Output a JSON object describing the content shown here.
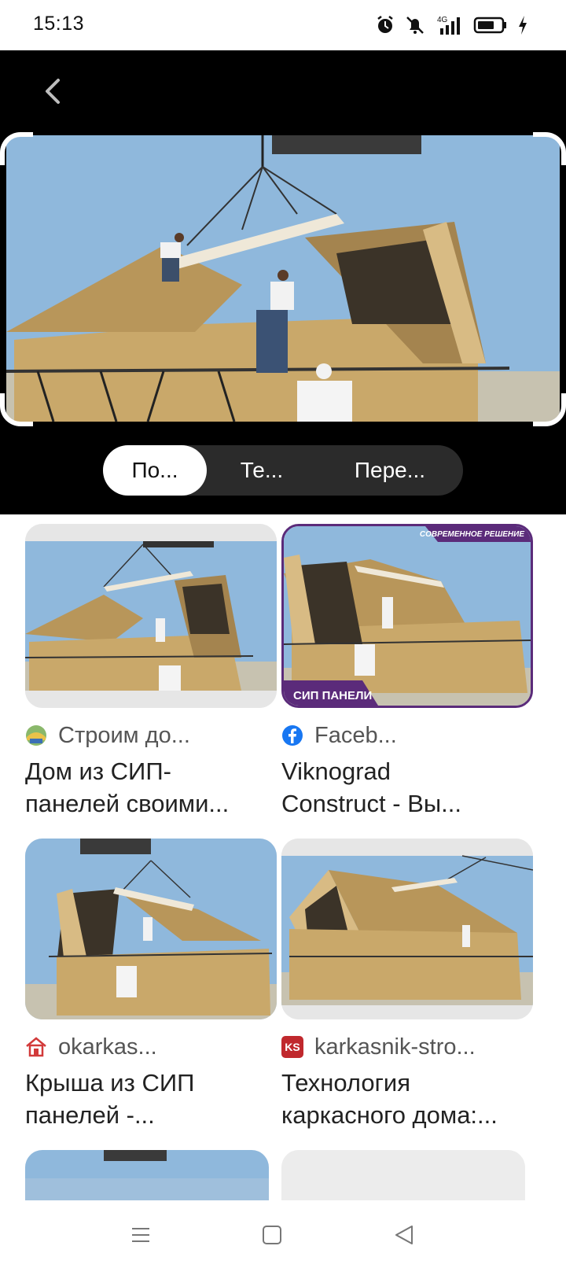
{
  "status": {
    "time": "15:13",
    "network": "4G",
    "icons": [
      "alarm-icon",
      "mute-icon",
      "signal-icon",
      "battery-icon",
      "charging-icon"
    ]
  },
  "viewer": {
    "back_icon": "chevron-left-icon",
    "tabs": [
      {
        "label": "По..."
      },
      {
        "label": "Те..."
      },
      {
        "label": "Пере..."
      }
    ],
    "active_tab": 0
  },
  "results": [
    {
      "source": "Строим до...",
      "source_icon": "site-icon",
      "title_line1": "Дом из СИП-",
      "title_line2": "панелей своими..."
    },
    {
      "source": "Faceb...",
      "source_icon": "facebook-icon",
      "title_line1": "Viknograd",
      "title_line2": "Construct - Вы...",
      "overlay_top": "СОВРЕМЕННОЕ РЕШЕНИЕ",
      "overlay_bottom": "СИП ПАНЕЛИ"
    },
    {
      "source": "okarkas...",
      "source_icon": "house-icon",
      "title_line1": "Крыша из СИП",
      "title_line2": "панелей -..."
    },
    {
      "source": "karkasnik-stro...",
      "source_icon": "ks-badge-icon",
      "badge": "KS",
      "title_line1": "Технология",
      "title_line2": "каркасного дома:..."
    }
  ],
  "colors": {
    "viewer_bg": "#000000",
    "sky": "#8db6d9",
    "osb": "#c9a86a",
    "segment_bg": "#2b2b2b",
    "facebook": "#1877f2",
    "ks_badge": "#c0282d",
    "overlay_purple": "#5b2b7a"
  }
}
